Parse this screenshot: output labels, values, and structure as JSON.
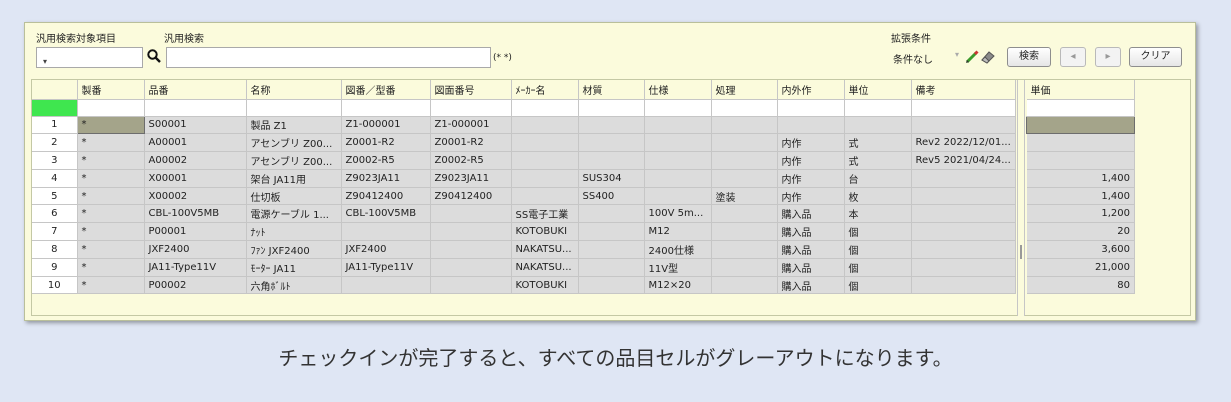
{
  "toolbar": {
    "field_label": "汎用検索対象項目",
    "field_value": "",
    "search_label": "汎用検索",
    "search_value": "",
    "search_hint": "(* *)",
    "extended_label": "拡張条件",
    "condition_value": "条件なし",
    "search_button": "検索",
    "prev_button": "◂",
    "next_button": "▸",
    "clear_button": "クリア"
  },
  "grid": {
    "columns": [
      "",
      "製番",
      "品番",
      "名称",
      "図番／型番",
      "図面番号",
      "ﾒｰｶｰ名",
      "材質",
      "仕様",
      "処理",
      "内外作",
      "単位",
      "備考"
    ],
    "price_column": "単価",
    "rows": [
      {
        "no": "1",
        "cells": [
          "*",
          "S00001",
          "製品 Z1",
          "Z1-000001",
          "Z1-000001",
          "",
          "",
          "",
          "",
          "",
          "",
          ""
        ],
        "price": ""
      },
      {
        "no": "2",
        "cells": [
          "*",
          "A00001",
          "アセンブリ Z00...",
          "Z0001-R2",
          "Z0001-R2",
          "",
          "",
          "",
          "",
          "内作",
          "式",
          "Rev2 2022/12/01..."
        ],
        "price": ""
      },
      {
        "no": "3",
        "cells": [
          "*",
          "A00002",
          "アセンブリ Z00...",
          "Z0002-R5",
          "Z0002-R5",
          "",
          "",
          "",
          "",
          "内作",
          "式",
          "Rev5 2021/04/24..."
        ],
        "price": ""
      },
      {
        "no": "4",
        "cells": [
          "*",
          "X00001",
          "架台 JA11用",
          "Z9023JA11",
          "Z9023JA11",
          "",
          "SUS304",
          "",
          "",
          "内作",
          "台",
          ""
        ],
        "price": "1,400"
      },
      {
        "no": "5",
        "cells": [
          "*",
          "X00002",
          "仕切板",
          "Z90412400",
          "Z90412400",
          "",
          "SS400",
          "",
          "塗装",
          "内作",
          "枚",
          ""
        ],
        "price": "1,400"
      },
      {
        "no": "6",
        "cells": [
          "*",
          "CBL-100V5MB",
          "電源ケーブル 1...",
          "CBL-100V5MB",
          "",
          "SS電子工業",
          "",
          "100V 5m...",
          "",
          "購入品",
          "本",
          ""
        ],
        "price": "1,200"
      },
      {
        "no": "7",
        "cells": [
          "*",
          "P00001",
          "ﾅｯﾄ",
          "",
          "",
          "KOTOBUKI",
          "",
          "M12",
          "",
          "購入品",
          "個",
          ""
        ],
        "price": "20"
      },
      {
        "no": "8",
        "cells": [
          "*",
          "JXF2400",
          "ﾌｧﾝ JXF2400",
          "JXF2400",
          "",
          "NAKATSU...",
          "",
          "2400仕様",
          "",
          "購入品",
          "個",
          ""
        ],
        "price": "3,600"
      },
      {
        "no": "9",
        "cells": [
          "*",
          "JA11-Type11V",
          "ﾓｰﾀｰ JA11",
          "JA11-Type11V",
          "",
          "NAKATSU...",
          "",
          "11V型",
          "",
          "購入品",
          "個",
          ""
        ],
        "price": "21,000"
      },
      {
        "no": "10",
        "cells": [
          "*",
          "P00002",
          "六角ﾎﾞﾙﾄ",
          "",
          "",
          "KOTOBUKI",
          "",
          "M12×20",
          "",
          "購入品",
          "個",
          ""
        ],
        "price": "80"
      }
    ]
  },
  "caption": "チェックインが完了すると、すべての品目セルがグレーアウトになります。",
  "colors": {
    "panel_bg": "#fbfbdc",
    "filter_marker": "#3fe64f",
    "cell_grayed": "#dcdcdc",
    "selected_cell": "#a4a48a"
  }
}
